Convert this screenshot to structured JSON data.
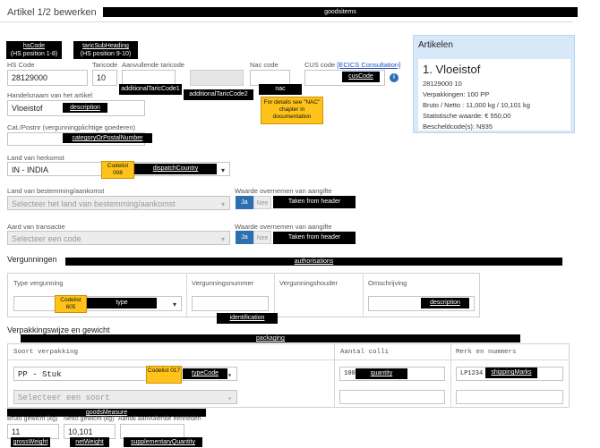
{
  "header": {
    "title": "Artikel 1/2 bewerken",
    "goodsitems_tag": "goodsitems"
  },
  "tags": {
    "hsCode": "hsCode",
    "hsCode_sub": "(HS position 1-8)",
    "taricSubHeading": "taricSubHeading",
    "taricSubHeading_sub": "(HS position 9-10)",
    "additionalTaricCode1": "additionalTaricCode1",
    "additionalTaricCode2": "additionalTaricCode2",
    "nac": "nac",
    "cusCode": "cusCode",
    "description": "description",
    "categoryOrPostalNumber": "categoryOrPostalNumber",
    "dispatchCountry": "dispatchCountry",
    "takenFromHeader": "Taken from header",
    "authorisations": "authorisations",
    "type": "type",
    "identification": "identification",
    "packaging": "packaging",
    "typeCode": "typeCode",
    "quantity": "quantity",
    "shippingMarks": "shippingMarks",
    "goodsMeasure": "goodsMeasure",
    "grossWeight": "grossWeight",
    "netWeight": "netWeight",
    "supplementaryQuantity": "supplementaryQuantity"
  },
  "notes": {
    "nac_note": "For details see \"NAC\" chapter in documentation",
    "codelist_008": "Codelist 008",
    "codelist_605": "Codelist 605",
    "codelist_017": "Codelist 017"
  },
  "form": {
    "hs_code_label": "HS Code",
    "hs_code_value": "28129000",
    "taric_code_label": "Taricode",
    "taric_code_value": "10",
    "aanvullende_label": "Aanvullende taricode",
    "nac_code_label": "Nac code",
    "cus_code_label": "CUS code",
    "cus_link": "[ECICS Consultation]",
    "handelsnaam_label": "Handelsnaam van het artikel",
    "handelsnaam_value": "Vloeistof",
    "cat_label": "Cat./Postnr (vergunningplichtige goederen)",
    "herkomst_label": "Land van herkomst",
    "herkomst_value": "IN - INDIA",
    "bestemming_label": "Land van bestemming/aankomst",
    "bestemming_placeholder": "Selecteer het land van bestemming/aankomst",
    "waarde_label_1": "Waarde overnemen van aangifte",
    "aard_label": "Aard van transactie",
    "aard_placeholder": "Selecteer een code",
    "waarde_label_2": "Waarde overnemen van aangifte",
    "ja": "Ja",
    "nee": "Nee"
  },
  "vergunningen": {
    "title": "Vergunningen",
    "col_type": "Type vergunning",
    "col_nummer": "Vergunningsnummer",
    "col_houder": "Vergunningshouder",
    "col_omschrijving": "Omschrijving"
  },
  "verpakking": {
    "title": "Verpakkingswijze en gewicht",
    "col_soort": "Soort verpakking",
    "col_colli": "Aantal colli",
    "col_merk": "Merk en nummers",
    "row1_soort": "PP - Stuk",
    "row1_colli": "100",
    "row1_merk": "LP1234",
    "row2_placeholder": "Selecteer een soort"
  },
  "gewicht": {
    "bruto_label": "Bruto gewicht (kg)",
    "netto_label": "Netto gewicht (kg)",
    "aanvullende_label": "Aantal aanvullende eenheden",
    "bruto_value": "11",
    "netto_value": "10,101"
  },
  "artikelen": {
    "title": "Artikelen",
    "item_title": "1. Vloeistof",
    "line1": "28129000 10",
    "line2": "Verpakkingen: 100 PP",
    "line3": "Bruto / Netto : 11,000 kg / 10,101 kg",
    "line4": "Statistische waarde: € 550,00",
    "line5": "Bescheldcode(s): N935"
  }
}
